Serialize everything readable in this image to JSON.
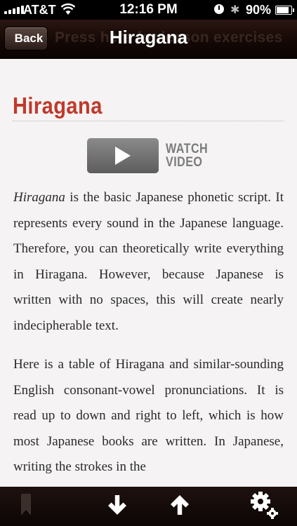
{
  "status_bar": {
    "carrier": "AT&T",
    "time": "12:16 PM",
    "battery": "90%"
  },
  "nav": {
    "back_label": "Back",
    "title": "Hiragana",
    "ghost_text": "Press here for lesson exercises"
  },
  "content": {
    "heading": "Hiragana",
    "watch_video_line1": "WATCH",
    "watch_video_line2": "VIDEO",
    "paragraph1_italic": "Hiragana",
    "paragraph1_rest": " is the basic Japanese phonetic script. It represents every sound in the Japanese language. Therefore, you can theoretically write everything in Hiragana. However, because Japanese is written with no spaces, this will create nearly indecipherable text.",
    "paragraph2": "Here is a table of Hiragana and similar-sounding English consonant-vowel pronunciations. It is read up to down and right to left, which is how most Japanese books are written. In Japanese, writing the strokes in the"
  },
  "toolbar": {
    "icons": [
      "bookmark-icon",
      "arrow-down-icon",
      "arrow-up-icon",
      "settings-icon"
    ]
  },
  "colors": {
    "heading": "#c0392b",
    "nav_bg": "#140805",
    "content_bg": "#f5f3f3"
  }
}
